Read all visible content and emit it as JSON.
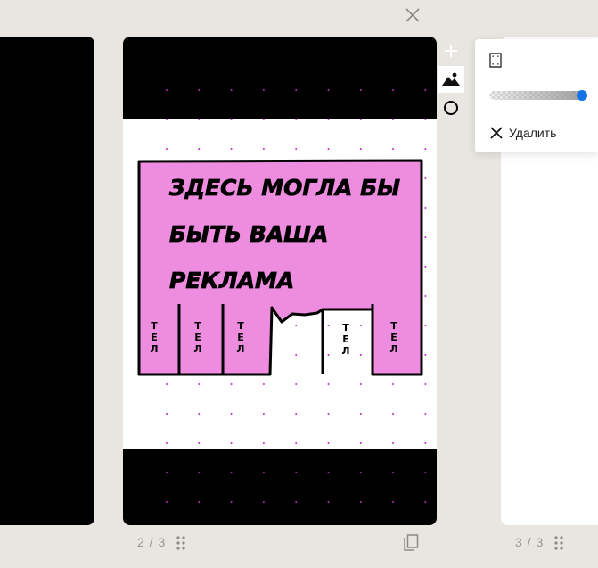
{
  "slides": {
    "current_label": "2 / 3",
    "next_label": "3 / 3"
  },
  "ad": {
    "line1": "ЗДЕСЬ МОГЛА БЫ",
    "line2": "БЫТЬ ВАША",
    "line3": "РЕКЛАМА",
    "tab_text": "ТЕЛ",
    "fill_color": "#ee8de0"
  },
  "popup": {
    "delete_label": "Удалить",
    "opacity": 1.0
  },
  "colors": {
    "accent": "#1273ea",
    "background": "#e9e6e1"
  },
  "icons": {
    "close": "close-icon",
    "add": "plus-icon",
    "image": "image-icon",
    "shape": "circle-icon",
    "format": "page-format-icon",
    "duplicate": "duplicate-icon",
    "drag": "drag-handle-icon"
  }
}
